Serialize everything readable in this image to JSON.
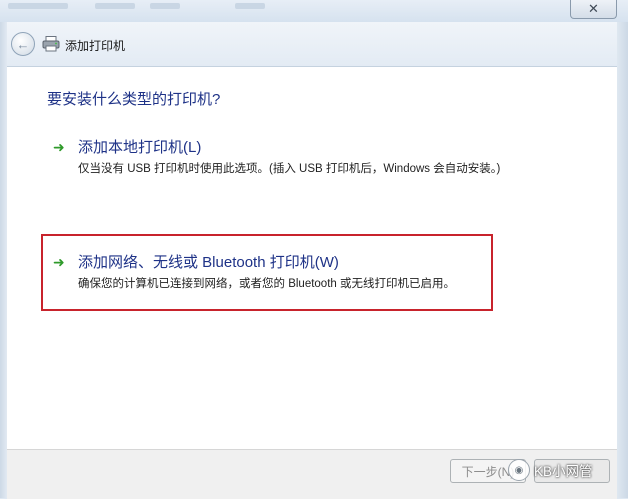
{
  "window": {
    "title": "添加打印机",
    "close_glyph": "✕",
    "back_glyph": "←"
  },
  "question": "要安装什么类型的打印机?",
  "options": [
    {
      "title": "添加本地打印机(L)",
      "description": "仅当没有 USB 打印机时使用此选项。(插入 USB 打印机后，Windows 会自动安装。)"
    },
    {
      "title": "添加网络、无线或 Bluetooth 打印机(W)",
      "description": "确保您的计算机已连接到网络，或者您的 Bluetooth 或无线打印机已启用。"
    }
  ],
  "arrow_glyph": "➜",
  "buttons": {
    "next_label": "下一步(N)"
  },
  "watermark": {
    "text": "KB小网管"
  },
  "colors": {
    "link_blue": "#1e3287",
    "arrow_green": "#2f9a2a",
    "highlight_red": "#c8232c"
  }
}
